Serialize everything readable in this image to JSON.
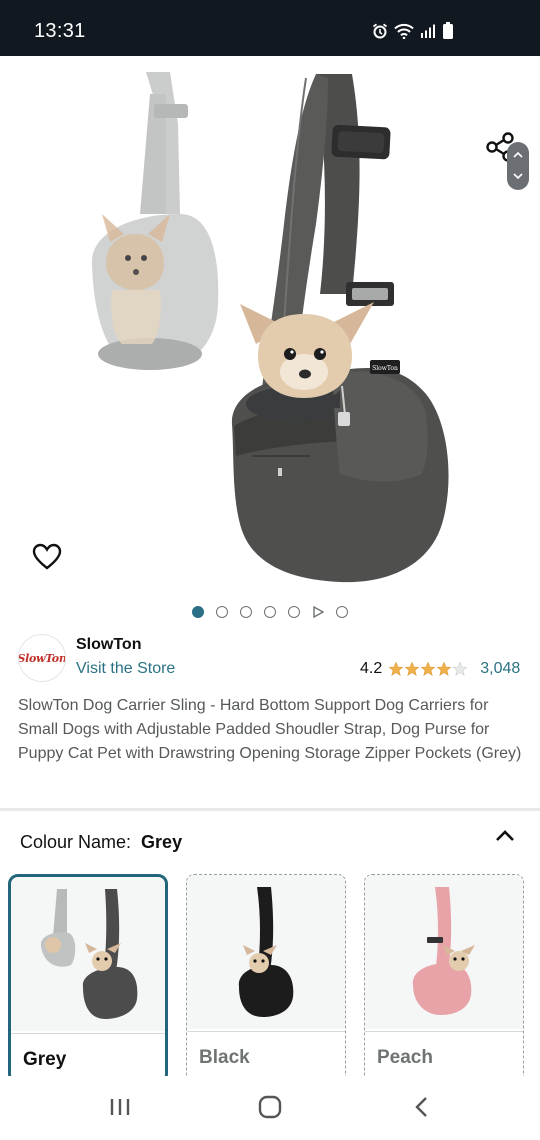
{
  "status_bar": {
    "time": "13:31",
    "icons": [
      "alarm-icon",
      "wifi-icon",
      "signal-icon",
      "battery-icon"
    ]
  },
  "gallery": {
    "image_count": 7,
    "active_index": 0,
    "video_index": 5
  },
  "brand": {
    "logo_text": "SlowTon",
    "name": "SlowTon",
    "visit_store": "Visit the Store"
  },
  "rating": {
    "value": "4.2",
    "stars": 4.2,
    "reviews": "3,048"
  },
  "product": {
    "title": "SlowTon Dog Carrier Sling - Hard Bottom Support Dog Carriers for Small Dogs with Adjustable Padded Shoudler Strap, Dog Purse for Puppy Cat Pet with Drawstring Opening Storage Zipper Pockets (Grey)"
  },
  "variation": {
    "label": "Colour Name:",
    "selected": "Grey",
    "options": [
      {
        "name": "Grey",
        "color": "#4b4c4b"
      },
      {
        "name": "Black",
        "color": "#1c1c1c"
      },
      {
        "name": "Peach",
        "color": "#e8a3a8"
      }
    ]
  },
  "colors": {
    "accent": "#23657a",
    "link": "#2a7283",
    "star": "#f1b04c",
    "status_bar": "#111820"
  }
}
